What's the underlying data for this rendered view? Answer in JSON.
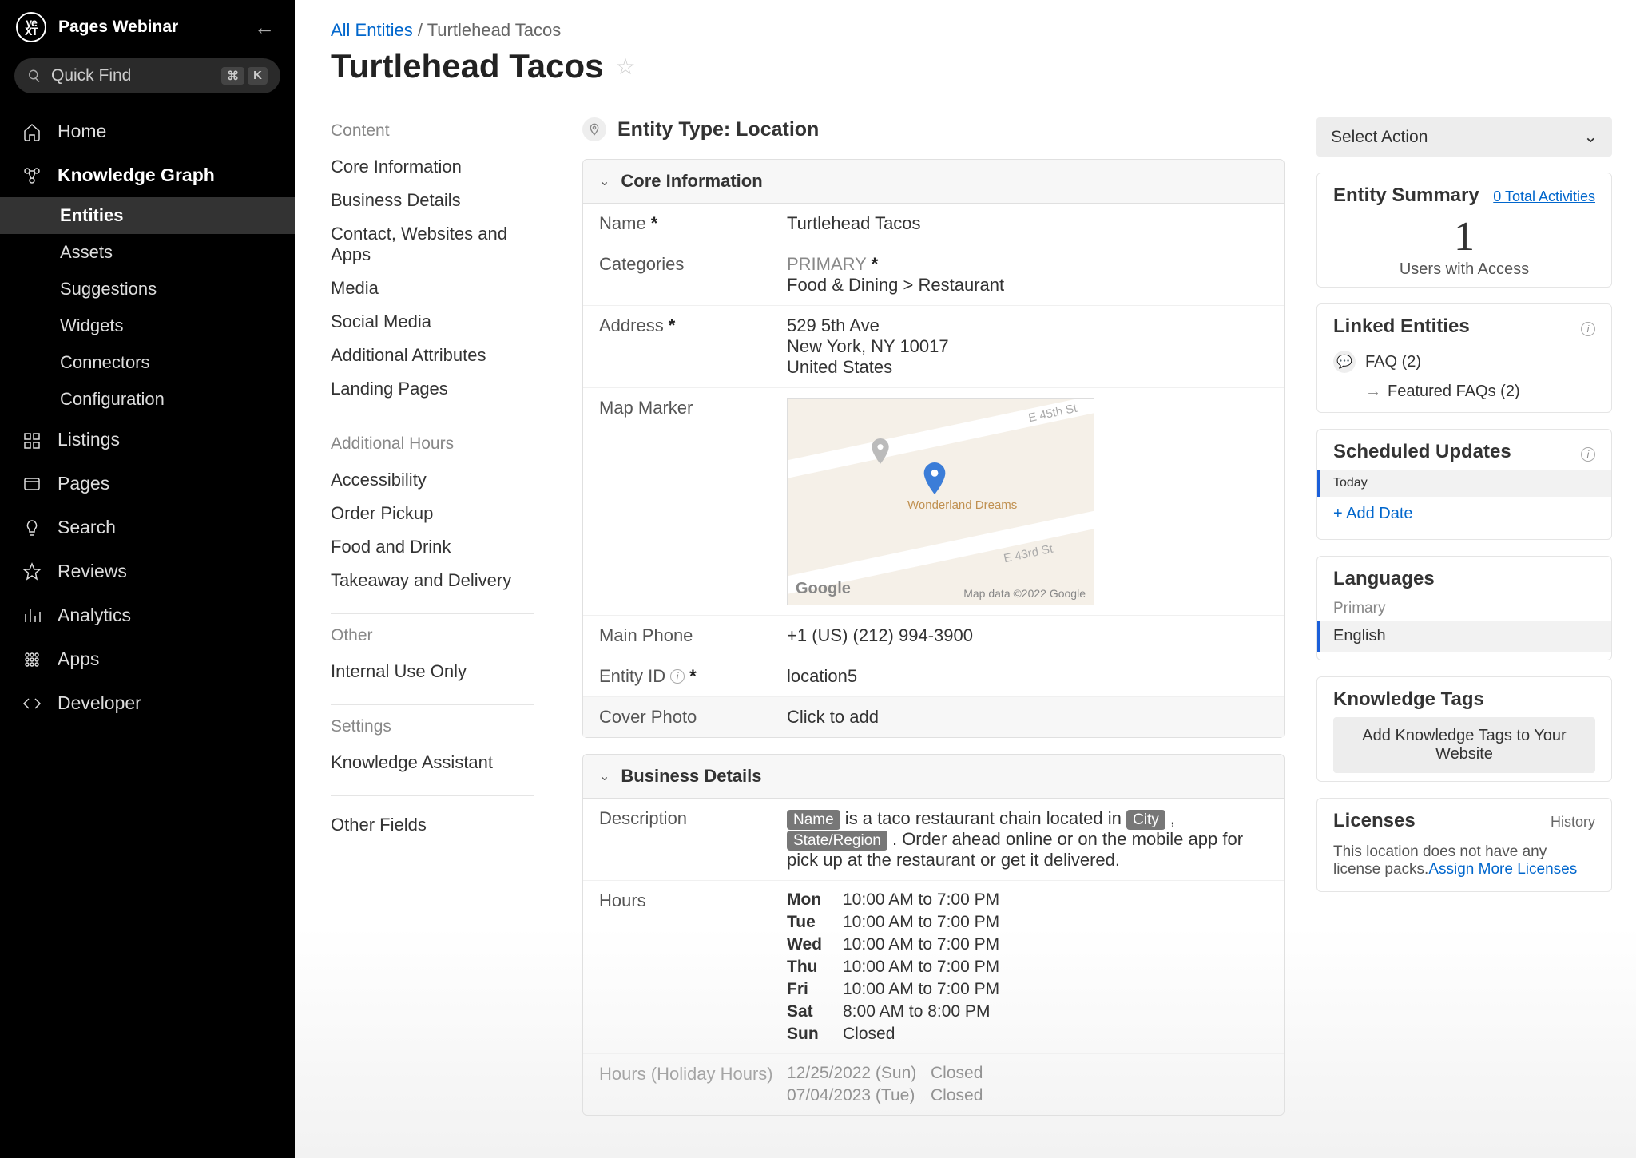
{
  "workspace": {
    "name": "Pages Webinar",
    "logo_top": "ye",
    "logo_bot": "XT"
  },
  "quickfind": {
    "placeholder": "Quick Find",
    "kbd1": "⌘",
    "kbd2": "K"
  },
  "nav": {
    "home": "Home",
    "kg": "Knowledge Graph",
    "kg_items": [
      "Entities",
      "Assets",
      "Suggestions",
      "Widgets",
      "Connectors",
      "Configuration"
    ],
    "listings": "Listings",
    "pages": "Pages",
    "search": "Search",
    "reviews": "Reviews",
    "analytics": "Analytics",
    "apps": "Apps",
    "developer": "Developer"
  },
  "breadcrumb": {
    "root": "All Entities",
    "sep": "/",
    "current": "Turtlehead Tacos"
  },
  "page_title": "Turtlehead Tacos",
  "content_nav": {
    "content_label": "Content",
    "content_items": [
      "Core Information",
      "Business Details",
      "Contact, Websites and Apps",
      "Media",
      "Social Media",
      "Additional Attributes",
      "Landing Pages"
    ],
    "additional_label": "Additional Hours",
    "additional_items": [
      "Accessibility",
      "Order Pickup",
      "Food and Drink",
      "Takeaway and Delivery"
    ],
    "other_label": "Other",
    "other_items": [
      "Internal Use Only"
    ],
    "settings_label": "Settings",
    "settings_items": [
      "Knowledge Assistant"
    ],
    "other_fields": "Other Fields"
  },
  "entity_type": "Entity Type: Location",
  "core": {
    "title": "Core Information",
    "name_label": "Name",
    "name_value": "Turtlehead Tacos",
    "categories_label": "Categories",
    "categories_primary": "PRIMARY",
    "categories_value": "Food & Dining > Restaurant",
    "address_label": "Address",
    "address_line1": "529 5th Ave",
    "address_line2": "New York, NY 10017",
    "address_line3": "United States",
    "map_label": "Map Marker",
    "map_place": "Wonderland Dreams",
    "map_street1": "E 45th St",
    "map_street2": "E 43rd St",
    "map_google": "Google",
    "map_attr": "Map data ©2022 Google",
    "phone_label": "Main Phone",
    "phone_value": "+1 (US) (212) 994-3900",
    "entityid_label": "Entity ID",
    "entityid_value": "location5",
    "cover_label": "Cover Photo",
    "cover_value": "Click to add"
  },
  "business": {
    "title": "Business Details",
    "desc_label": "Description",
    "desc_pill1": "Name",
    "desc_text1": " is a taco restaurant chain located in ",
    "desc_pill2": "City",
    "desc_comma": " , ",
    "desc_pill3": "State/Region",
    "desc_text2": " . Order ahead online or on the mobile app for pick up at the restaurant or get it delivered.",
    "hours_label": "Hours",
    "hours": [
      {
        "d": "Mon",
        "v": "10:00 AM to 7:00 PM"
      },
      {
        "d": "Tue",
        "v": "10:00 AM to 7:00 PM"
      },
      {
        "d": "Wed",
        "v": "10:00 AM to 7:00 PM"
      },
      {
        "d": "Thu",
        "v": "10:00 AM to 7:00 PM"
      },
      {
        "d": "Fri",
        "v": "10:00 AM to 7:00 PM"
      },
      {
        "d": "Sat",
        "v": "8:00 AM to 8:00 PM"
      },
      {
        "d": "Sun",
        "v": "Closed"
      }
    ],
    "holiday_label": "Hours (Holiday Hours)",
    "holiday": [
      {
        "d": "12/25/2022 (Sun)",
        "v": "Closed"
      },
      {
        "d": "07/04/2023 (Tue)",
        "v": "Closed"
      }
    ]
  },
  "right": {
    "select_action": "Select Action",
    "summary_title": "Entity Summary",
    "summary_link": "0 Total Activities",
    "summary_num": "1",
    "summary_label": "Users with Access",
    "linked_title": "Linked Entities",
    "faq_label": "FAQ (2)",
    "faq_sub": "Featured FAQs (2)",
    "scheduled_title": "Scheduled Updates",
    "scheduled_today": "Today",
    "scheduled_add": "+ Add Date",
    "languages_title": "Languages",
    "languages_primary": "Primary",
    "languages_value": "English",
    "kt_title": "Knowledge Tags",
    "kt_button": "Add Knowledge Tags to Your Website",
    "licenses_title": "Licenses",
    "licenses_history": "History",
    "licenses_text": "This location does not have any license packs.",
    "licenses_link": "Assign More Licenses"
  }
}
